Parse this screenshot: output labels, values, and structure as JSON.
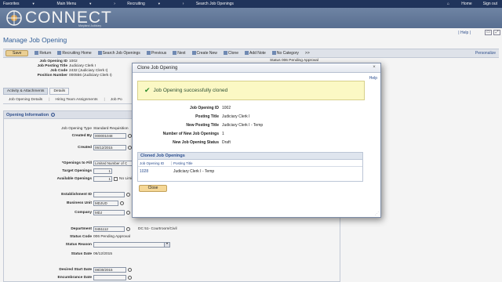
{
  "topnav": {
    "favorites": "Favorites",
    "main_menu": "Main Menu",
    "recruiting": "Recruiting",
    "breadcrumb_sep": "›",
    "breadcrumb_current": "Search Job Openings",
    "home": "Home",
    "sign_out": "Sign out"
  },
  "banner": {
    "logo": "CONNECT",
    "subtitle": "Maryland Judiciary"
  },
  "page": {
    "help": "Help",
    "title": "Manage Job Opening"
  },
  "toolbar": {
    "save": "Save",
    "return": "Return",
    "recruiting_home": "Recruiting Home",
    "search_job_openings": "Search Job Openings",
    "previous": "Previous",
    "next": "Next",
    "create_new": "Create New",
    "clone": "Clone",
    "add_note": "Add Note",
    "no_category": "No Category",
    "more": ">>",
    "personalize": "Personalize"
  },
  "job": {
    "opening_id_label": "Job Opening ID",
    "opening_id": "1002",
    "posting_title_label": "Job Posting Title",
    "posting_title": "Judiciary Clerk I",
    "job_code_label": "Job Code",
    "job_code": "2432 (Judiciary Clerk I)",
    "position_label": "Position Number",
    "position": "000556 (Judiciary Clerk I)",
    "status_label": "Status",
    "status": "006 Pending Approval"
  },
  "tabs_primary": [
    "Activity & Attachments",
    "Details"
  ],
  "tabs_secondary": [
    "Job Opening Details",
    "Hiring Team Assignments",
    "Job Po"
  ],
  "form": {
    "section_title": "Opening Information",
    "opening_type_label": "Job Opening Type",
    "opening_type": "Standard Requisition",
    "created_by_label": "Created By",
    "created_by": "000001048",
    "created_label": "Created",
    "created": "06/12/2015",
    "openings_to_fill_label": "*Openings to Fill",
    "openings_to_fill": "Limited Number of C",
    "target_openings_label": "Target Openings",
    "target_openings": "1",
    "available_openings_label": "Available Openings",
    "available_openings": "1",
    "no_limit_label": "No Limit",
    "establishment_label": "Establishment ID",
    "establishment": "",
    "business_unit_label": "Business Unit",
    "business_unit": "MDJUD",
    "company_label": "Company",
    "company": "MDJ",
    "department_label": "Department",
    "department": "0451112",
    "department_desc": "DC 51- Courtroom/Civil",
    "status_code_label": "Status Code",
    "status_code": "006 Pending Approval",
    "status_reason_label": "Status Reason",
    "status_reason": "",
    "status_date_label": "Status Date",
    "status_date": "06/12/2015",
    "desired_start_label": "Desired Start Date",
    "desired_start": "08/30/2015",
    "encumbrance_label": "Encumbrance Date",
    "encumbrance": ""
  },
  "modal": {
    "title": "Clone Job Opening",
    "close": "×",
    "help": "Help",
    "success": "Job Opening successfully cloned",
    "rows": [
      {
        "label": "Job Opening ID",
        "value": "1002"
      },
      {
        "label": "Posting Title",
        "value": "Judiciary Clerk I"
      },
      {
        "label": "New Posting Title",
        "value": "Judiciary Clerk I - Temp"
      },
      {
        "label": "Number of New Job Openings",
        "value": "1"
      },
      {
        "label": "New Job Opening Status",
        "value": "Draft"
      }
    ],
    "grid_title": "Cloned Job Openings",
    "grid_col1": "Job Opening ID",
    "grid_col2": "Posting Title",
    "grid_row": {
      "id": "1028",
      "title": "Judiciary Clerk I - Temp"
    },
    "close_button": "Close"
  }
}
